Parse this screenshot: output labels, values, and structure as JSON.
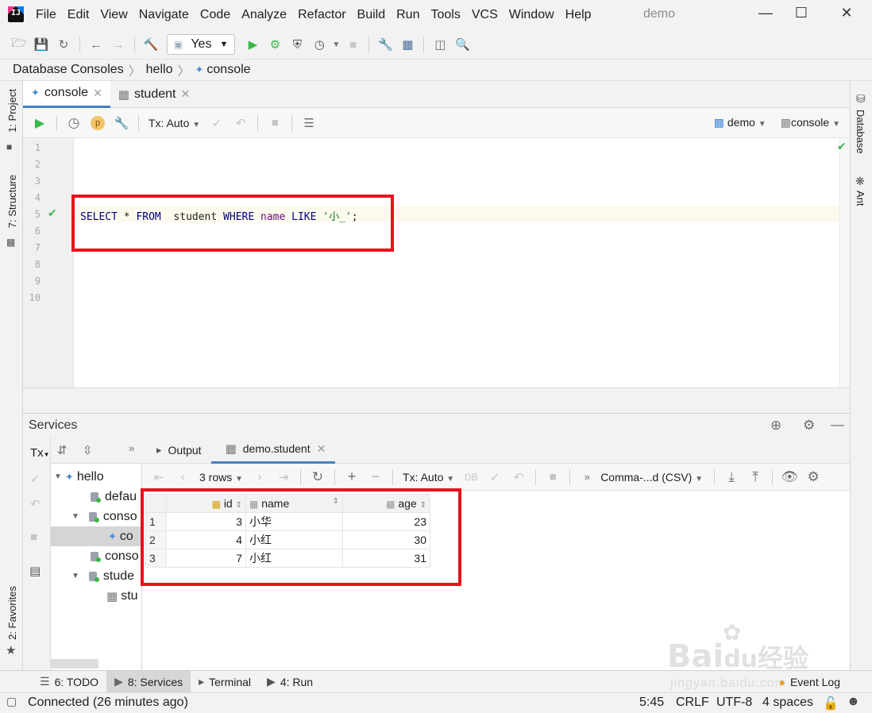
{
  "window": {
    "menu": [
      "File",
      "Edit",
      "View",
      "Navigate",
      "Code",
      "Analyze",
      "Refactor",
      "Build",
      "Run",
      "Tools",
      "VCS",
      "Window",
      "Help"
    ],
    "title": "demo"
  },
  "toolbar": {
    "run_config": "Yes"
  },
  "breadcrumb": [
    "Database Consoles",
    "hello",
    "console"
  ],
  "side_tools": {
    "left_top": [
      "1: Project",
      "7: Structure"
    ],
    "left_bottom": "2: Favorites",
    "right": [
      "Database",
      "Ant"
    ]
  },
  "editor_tabs": [
    {
      "label": "console",
      "icon": "console-icon"
    },
    {
      "label": "student",
      "icon": "table-icon"
    }
  ],
  "console_toolbar": {
    "tx_mode": "Tx: Auto",
    "datasource": "demo",
    "session": "console"
  },
  "editor": {
    "line_numbers": [
      "1",
      "2",
      "3",
      "4",
      "5",
      "6",
      "7",
      "8",
      "9",
      "10"
    ],
    "sql": {
      "select": "SELECT",
      "star": " * ",
      "from": "FROM",
      "table": "  student ",
      "where": "WHERE",
      "column": "name",
      "like": "LIKE",
      "pattern": "'小_'",
      "end": ";"
    }
  },
  "services": {
    "title": "Services",
    "tx_label": "Tx",
    "tree": [
      {
        "label": "hello",
        "level": 0
      },
      {
        "label": "defau",
        "level": 1
      },
      {
        "label": "conso",
        "level": 1
      },
      {
        "label": "co",
        "level": 2
      },
      {
        "label": "conso",
        "level": 1
      },
      {
        "label": "stude",
        "level": 1
      },
      {
        "label": "stu",
        "level": 2
      }
    ],
    "result_tabs": [
      "Output",
      "demo.student"
    ],
    "rows_selector": "3 rows",
    "tx_mode": "Tx: Auto",
    "export_format": "Comma-...d (CSV)"
  },
  "result_grid": {
    "columns": [
      "id",
      "name",
      "age"
    ],
    "rows": [
      {
        "n": "1",
        "id": "3",
        "name": "小华",
        "age": "23"
      },
      {
        "n": "2",
        "id": "4",
        "name": "小红",
        "age": "30"
      },
      {
        "n": "3",
        "id": "7",
        "name": "小红",
        "age": "31"
      }
    ]
  },
  "bottom_tabs": [
    {
      "label": "6: TODO"
    },
    {
      "label": "8: Services"
    },
    {
      "label": "Terminal"
    },
    {
      "label": "4: Run"
    },
    {
      "label": "Event Log"
    }
  ],
  "status_bar": {
    "message": "Connected (26 minutes ago)",
    "position": "5:45",
    "line_sep": "CRLF",
    "encoding": "UTF-8",
    "indent": "4 spaces"
  },
  "watermark": {
    "brand": "Bai",
    "brand2": "du",
    "cn": "经验",
    "url": "jingyan.baidu.com"
  },
  "colors": {
    "highlight_box": "#e8121c",
    "run_green": "#3cb54a",
    "accent_blue": "#4083c9"
  }
}
